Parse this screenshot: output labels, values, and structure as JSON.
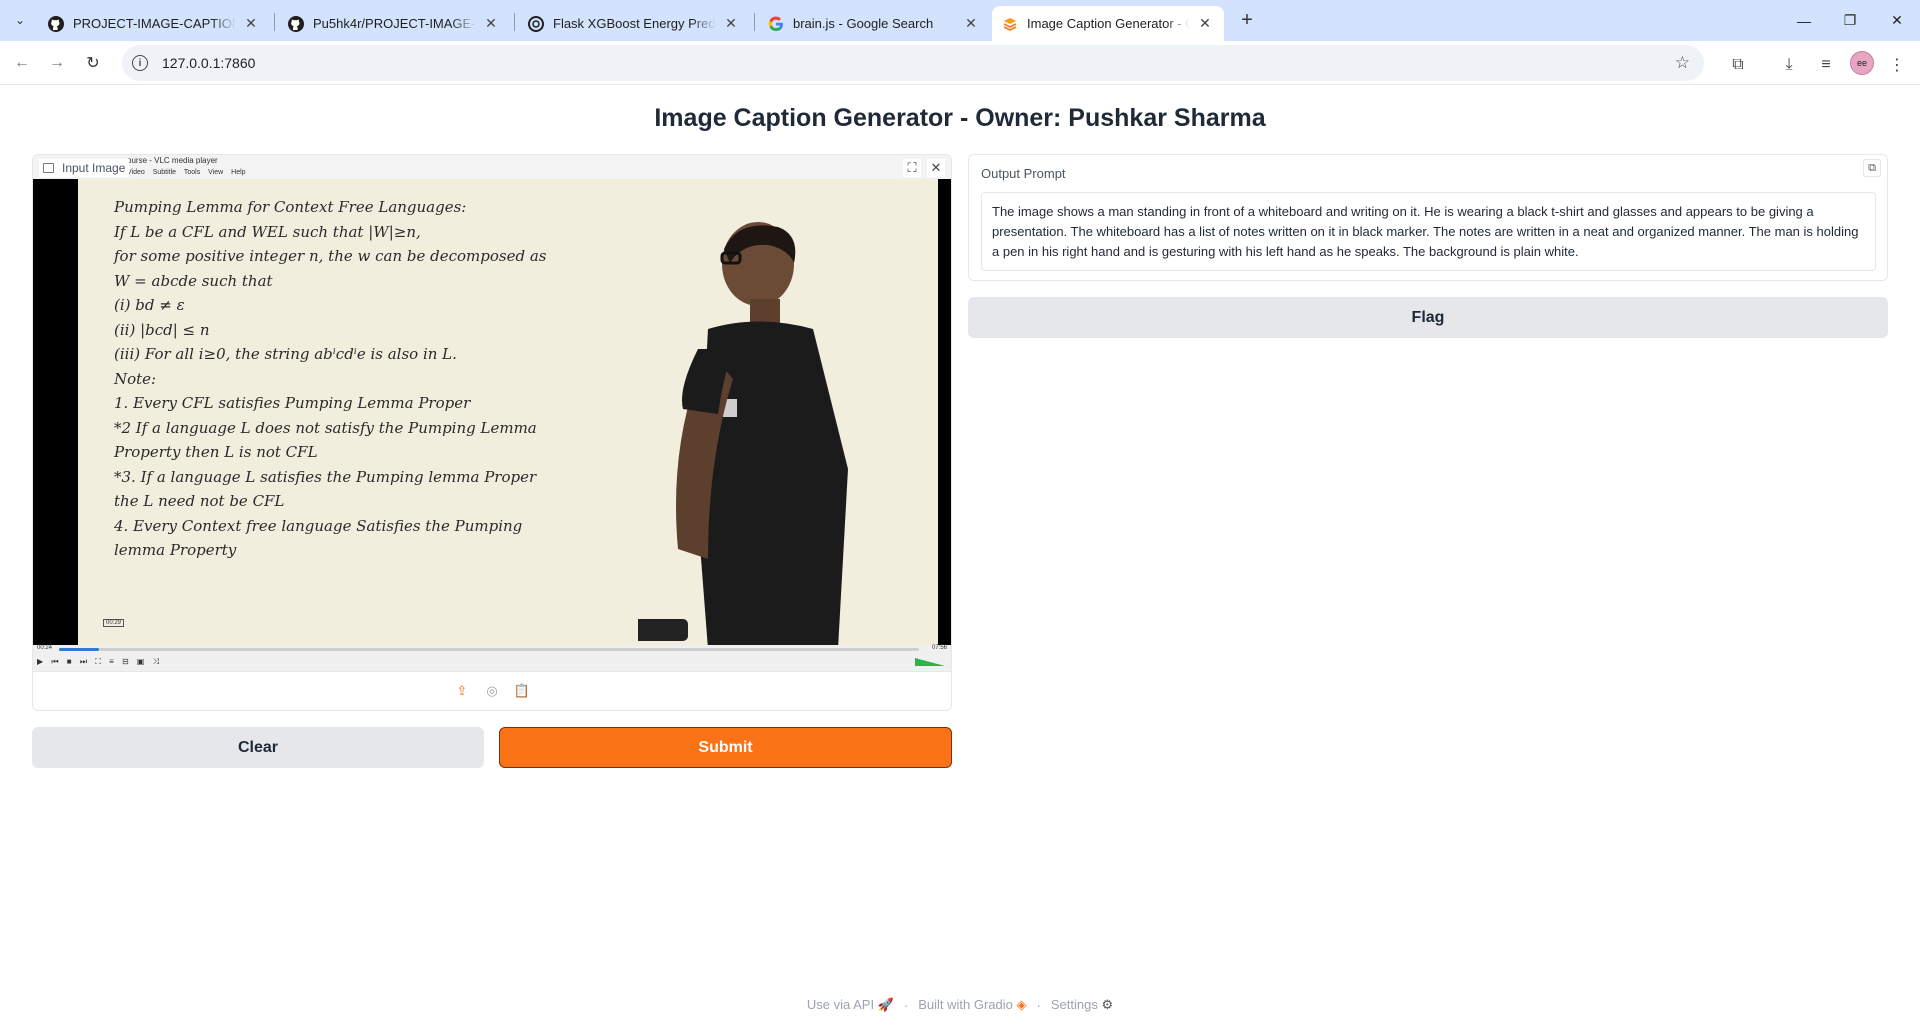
{
  "browser": {
    "tabs": [
      {
        "title": "PROJECT-IMAGE-CAPTION-GE",
        "icon": "github-icon"
      },
      {
        "title": "Pu5hk4r/PROJECT-IMAGE-CAPT",
        "icon": "github-icon"
      },
      {
        "title": "Flask XGBoost Energy Predictio",
        "icon": "openai-icon"
      },
      {
        "title": "brain.js - Google Search",
        "icon": "google-icon"
      },
      {
        "title": "Image Caption Generator - Own",
        "icon": "gradio-icon",
        "active": true
      }
    ],
    "url": "127.0.0.1:7860"
  },
  "app": {
    "title": "Image Caption Generator - Owner: Pushkar Sharma",
    "input": {
      "label": "Input Image",
      "vlc_title": "ourse - VLC media player",
      "vlc_menu": "Video Subtitle Tools View Help",
      "vlc_time_start": "00:24",
      "vlc_time_end": "07:56",
      "vlc_timestamp": "00:29",
      "vlc_progress": 0.047,
      "board_lines": [
        "Pumping Lemma for Context Free Languages:",
        "If L be a CFL and WEL such that |W|≥n,",
        "for some positive integer n, the w can be decomposed as",
        "W = abcde  such that",
        "(i)  bd ≠ ε",
        "(ii)  |bcd| ≤ n",
        "(iii)  For all i≥0,  the string  abⁱcdⁱe  is also in L.",
        "Note:",
        "1.  Every CFL satisfies  Pumping Lemma Proper",
        "*2  If a language L does not satisfy the Pumping Lemma",
        "     Property then L is not CFL",
        "*3.  If a language L satisfies the Pumping lemma Proper",
        "     the L need not be CFL",
        "4.  Every Context free language Satisfies the Pumping",
        "     lemma Property"
      ]
    },
    "buttons": {
      "clear": "Clear",
      "submit": "Submit",
      "flag": "Flag"
    },
    "output": {
      "label": "Output Prompt",
      "text": "The image shows a man standing in front of a whiteboard and writing on it. He is wearing a black t-shirt and glasses and appears to be giving a presentation. The whiteboard has a list of notes written on it in black marker. The notes are written in a neat and organized manner. The man is holding a pen in his right hand and is gesturing with his left hand as he speaks. The background is plain white."
    },
    "footer": {
      "api": "Use via API",
      "built": "Built with Gradio",
      "settings": "Settings"
    }
  },
  "colors": {
    "accent": "#f97316",
    "tabbar": "#d3e3fd"
  }
}
